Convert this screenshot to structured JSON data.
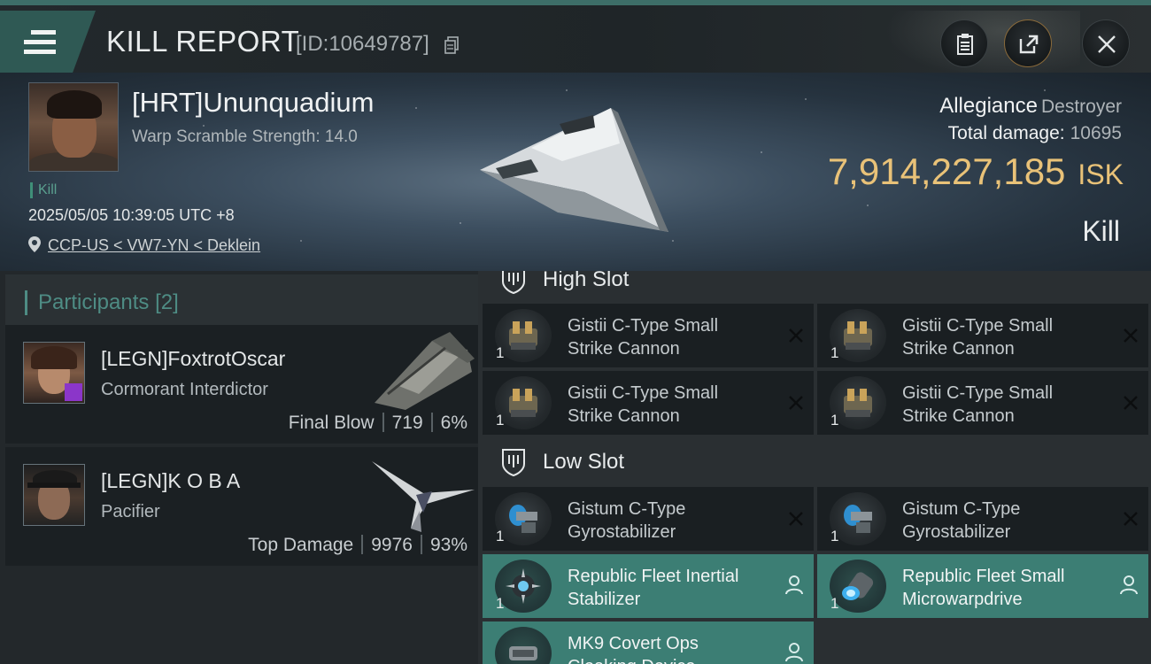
{
  "header": {
    "title": "KILL REPORT",
    "report_id": "[ID:10649787]"
  },
  "victim": {
    "name": "[HRT]Ununquadium",
    "warp_scramble": "Warp Scramble Strength: 14.0",
    "tag": "Kill",
    "datetime": "2025/05/05 10:39:05 UTC +8",
    "location": "CCP-US < VW7-YN < Deklein",
    "allegiance_label": "Allegiance",
    "allegiance_value": "Destroyer",
    "total_damage_label": "Total damage:",
    "total_damage_value": "10695",
    "isk_value": "7,914,227,185",
    "isk_unit": "ISK",
    "result_label": "Kill"
  },
  "participants": {
    "title": "Participants",
    "count": "[2]",
    "items": [
      {
        "name": "[LEGN]FoxtrotOscar",
        "ship": "Cormorant Interdictor",
        "role": "Final Blow",
        "damage": "719",
        "percent": "6%"
      },
      {
        "name": "[LEGN]K O B A",
        "ship": "Pacifier",
        "role": "Top Damage",
        "damage": "9976",
        "percent": "93%"
      }
    ]
  },
  "fitting": {
    "high_slot_label": "High Slot",
    "low_slot_label": "Low Slot",
    "high": [
      {
        "qty": "1",
        "line1": "Gistii C-Type Small",
        "line2": "Strike Cannon"
      },
      {
        "qty": "1",
        "line1": "Gistii C-Type Small",
        "line2": "Strike Cannon"
      },
      {
        "qty": "1",
        "line1": "Gistii C-Type Small",
        "line2": "Strike Cannon"
      },
      {
        "qty": "1",
        "line1": "Gistii C-Type Small",
        "line2": "Strike Cannon"
      }
    ],
    "low": [
      {
        "qty": "1",
        "line1": "Gistum C-Type",
        "line2": "Gyrostabilizer"
      },
      {
        "qty": "1",
        "line1": "Gistum C-Type",
        "line2": "Gyrostabilizer"
      },
      {
        "qty": "1",
        "line1": "Republic Fleet Inertial",
        "line2": "Stabilizer"
      },
      {
        "qty": "1",
        "line1": "Republic Fleet Small",
        "line2": "Microwarpdrive"
      },
      {
        "qty": "",
        "line1": "MK9 Covert Ops",
        "line2": "Cloaking Device"
      }
    ]
  },
  "colors": {
    "accent_teal": "#3c7e74",
    "isk_gold": "#e9c278",
    "badge_purple": "#8b36c9"
  }
}
